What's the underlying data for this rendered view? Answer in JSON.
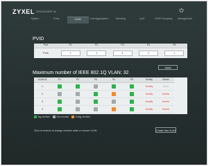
{
  "header": {
    "brand": "ZYXEL",
    "model": "GS1200-8HP v2"
  },
  "tabs": [
    {
      "label": "System"
    },
    {
      "label": "Ports"
    },
    {
      "label": "VLAN"
    },
    {
      "label": "Link Aggregation"
    },
    {
      "label": "Mirroring"
    },
    {
      "label": "QoS"
    },
    {
      "label": "IGMP Snooping"
    },
    {
      "label": "Management"
    }
  ],
  "pvid": {
    "title": "PVID",
    "port_label": "Port",
    "row_label": "PVID",
    "ports": [
      "P1",
      "P2",
      "P3",
      "P4",
      "P5"
    ],
    "values": [
      "1",
      "1",
      "4",
      "2",
      "1"
    ]
  },
  "apply_label": "Apply",
  "vlan": {
    "title": "Maximum number of IEEE 802.1Q VLAN: 32",
    "headers": [
      "VLAN ID",
      "P1",
      "P2",
      "P3",
      "P4",
      "P5",
      "Modify",
      "Delete"
    ],
    "rows": [
      {
        "id": "1",
        "modify": "Modify",
        "delete": "Don't",
        "cells": [
          "t",
          "t",
          "u",
          "t",
          "t"
        ]
      },
      {
        "id": "2",
        "modify": "Modify",
        "delete": "Delete",
        "cells": [
          "u",
          "u",
          "t",
          "x",
          "t"
        ]
      },
      {
        "id": "3",
        "modify": "Modify",
        "delete": "Delete",
        "cells": [
          "t",
          "u",
          "t",
          "u",
          "t"
        ]
      },
      {
        "id": "4",
        "modify": "Modify",
        "delete": "Delete",
        "cells": [
          "t",
          "u",
          "u",
          "x",
          "t"
        ]
      }
    ]
  },
  "legend": [
    {
      "key": "t",
      "label": "Tag member",
      "color": "#2eb24d"
    },
    {
      "key": "u",
      "label": "Not member",
      "color": "#a3a9a9"
    },
    {
      "key": "x",
      "label": "Untag member",
      "color": "#f28a2e"
    }
  ],
  "hint": "Click on buttons to change member state or remove VLAN.",
  "create_label": "Create New VLAN"
}
